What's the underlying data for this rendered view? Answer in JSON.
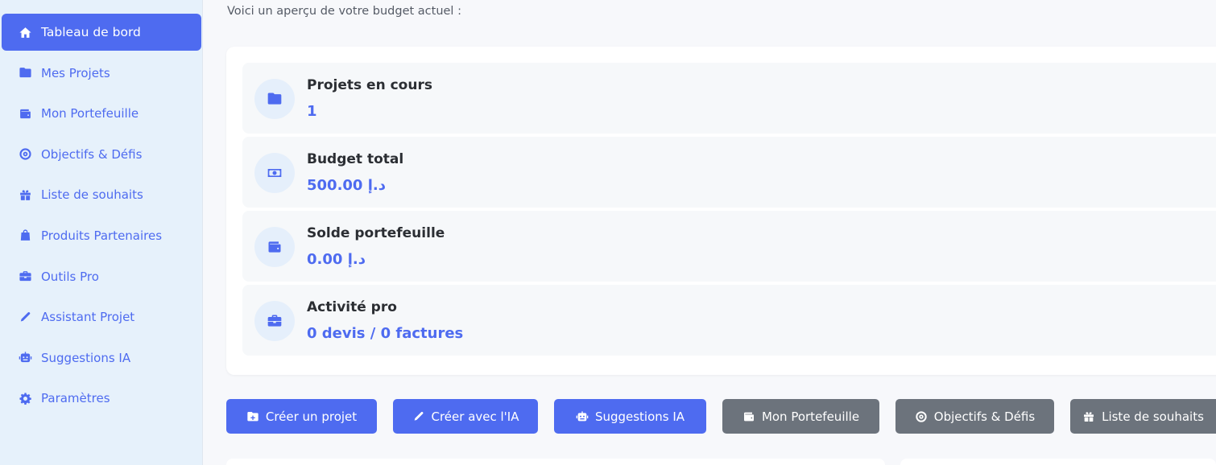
{
  "sidebar": {
    "items": [
      {
        "label": "Tableau de bord",
        "icon": "home-icon"
      },
      {
        "label": "Mes Projets",
        "icon": "folder-icon"
      },
      {
        "label": "Mon Portefeuille",
        "icon": "wallet-icon"
      },
      {
        "label": "Objectifs & Défis",
        "icon": "target-icon"
      },
      {
        "label": "Liste de souhaits",
        "icon": "gift-icon"
      },
      {
        "label": "Produits Partenaires",
        "icon": "shopping-bag-icon"
      },
      {
        "label": "Outils Pro",
        "icon": "briefcase-icon"
      },
      {
        "label": "Assistant Projet",
        "icon": "pencil-icon"
      },
      {
        "label": "Suggestions IA",
        "icon": "robot-icon"
      },
      {
        "label": "Paramètres",
        "icon": "gear-icon"
      }
    ]
  },
  "main": {
    "intro": "Voici un aperçu de votre budget actuel :",
    "stats": [
      {
        "label": "Projets en cours",
        "value": "1",
        "icon": "folder-icon"
      },
      {
        "label": "Budget total",
        "value": "500.00 د.إ",
        "icon": "money-bill-icon"
      },
      {
        "label": "Solde portefeuille",
        "value": "0.00 د.إ",
        "icon": "wallet-icon"
      },
      {
        "label": "Activité pro",
        "value": "0 devis / 0 factures",
        "icon": "briefcase-icon"
      }
    ],
    "actions": [
      {
        "label": "Créer un projet",
        "icon": "folder-plus-icon"
      },
      {
        "label": "Créer avec l'IA",
        "icon": "pencil-icon"
      },
      {
        "label": "Suggestions IA",
        "icon": "robot-icon"
      },
      {
        "label": "Mon Portefeuille",
        "icon": "wallet-icon"
      },
      {
        "label": "Objectifs & Défis",
        "icon": "target-icon"
      },
      {
        "label": "Liste de souhaits",
        "icon": "gift-icon"
      }
    ]
  },
  "colors": {
    "accent": "#4e6bf0",
    "secondary_button": "#6c737c",
    "sidebar_bg": "#e6f1fb"
  }
}
